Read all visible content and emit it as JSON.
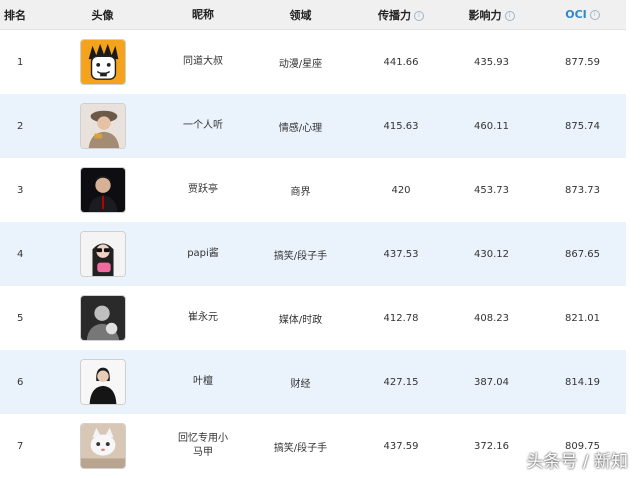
{
  "headers": {
    "rank": "排名",
    "avatar": "头像",
    "nickname": "昵称",
    "field": "领域",
    "spread": "传播力",
    "influence": "影响力",
    "oci": "OCI"
  },
  "rows": [
    {
      "rank": "1",
      "name": "同道大叔",
      "field": "动漫/星座",
      "spread": "441.66",
      "influence": "435.93",
      "oci": "877.59",
      "avatar_icon": "cartoon-uncle-avatar"
    },
    {
      "rank": "2",
      "name": "一个人听",
      "field": "情感/心理",
      "spread": "415.63",
      "influence": "460.11",
      "oci": "875.74",
      "avatar_icon": "person-photo-avatar"
    },
    {
      "rank": "3",
      "name": "贾跃亭",
      "field": "商界",
      "spread": "420",
      "influence": "453.73",
      "oci": "873.73",
      "avatar_icon": "person-photo-avatar"
    },
    {
      "rank": "4",
      "name": "papi酱",
      "field": "搞笑/段子手",
      "spread": "437.53",
      "influence": "430.12",
      "oci": "867.65",
      "avatar_icon": "person-photo-avatar"
    },
    {
      "rank": "5",
      "name": "崔永元",
      "field": "媒体/时政",
      "spread": "412.78",
      "influence": "408.23",
      "oci": "821.01",
      "avatar_icon": "person-photo-avatar"
    },
    {
      "rank": "6",
      "name": "叶檀",
      "field": "财经",
      "spread": "427.15",
      "influence": "387.04",
      "oci": "814.19",
      "avatar_icon": "person-photo-avatar"
    },
    {
      "rank": "7",
      "name": "回忆专用小马甲",
      "field": "搞笑/段子手",
      "spread": "437.59",
      "influence": "372.16",
      "oci": "809.75",
      "avatar_icon": "cat-photo-avatar"
    }
  ],
  "watermark": "头条号 / 新知",
  "colors": {
    "header_bg": "#f0f0f0",
    "alt_row_bg": "#eaf3fb",
    "oci_header": "#2f86d2"
  }
}
